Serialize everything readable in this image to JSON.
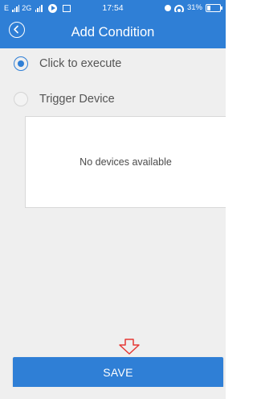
{
  "status_bar": {
    "network_left": "E",
    "network_right": "2G",
    "time": "17:54",
    "battery": "31%",
    "battery_level": 0.31,
    "icons": [
      "signal-icon",
      "media-play-icon",
      "image-icon",
      "alarm-icon",
      "wifi-icon",
      "battery-icon"
    ]
  },
  "header": {
    "title": "Add Condition",
    "back_icon": "back-arrow-icon"
  },
  "conditions": {
    "options": [
      {
        "label": "Click to execute",
        "selected": true
      },
      {
        "label": "Trigger Device",
        "selected": false
      }
    ],
    "device_list_empty_text": "No devices available"
  },
  "footer": {
    "save_label": "SAVE",
    "indicator_icon": "down-arrow-icon"
  },
  "colors": {
    "primary": "#2f7fd6",
    "background": "#efefef",
    "indicator": "#e53935"
  }
}
